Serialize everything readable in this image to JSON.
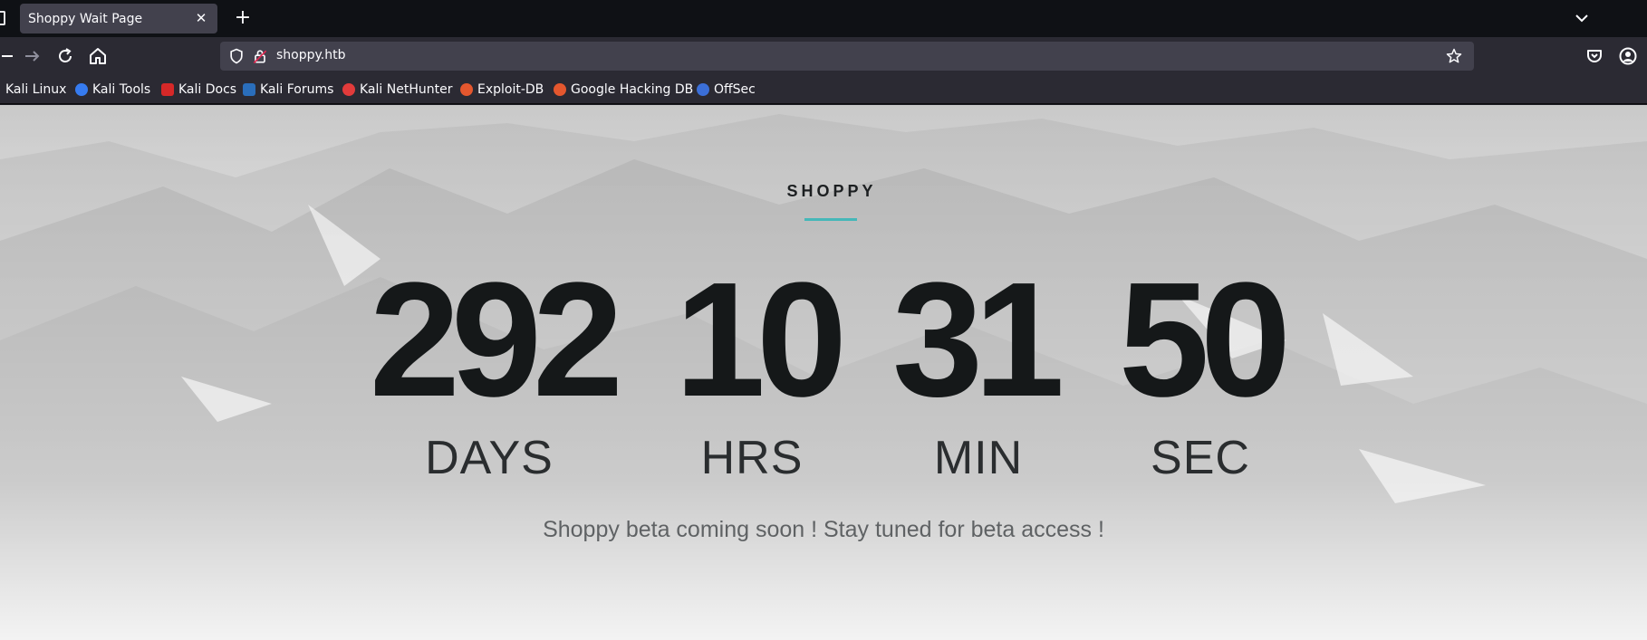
{
  "browser": {
    "tab": {
      "title": "Shoppy Wait Page"
    },
    "url": "shoppy.htb",
    "bookmarks": [
      {
        "label": "Kali Linux",
        "icon": "kali-dragon-icon",
        "color": "#367bf0"
      },
      {
        "label": "Kali Tools",
        "icon": "kali-tools-icon",
        "color": "#e33a3a"
      },
      {
        "label": "Kali Docs",
        "icon": "kali-docs-icon",
        "color": "#d62828"
      },
      {
        "label": "Kali Forums",
        "icon": "kali-forums-icon",
        "color": "#2a6ebb"
      },
      {
        "label": "Kali NetHunter",
        "icon": "kali-nethunter-icon",
        "color": "#e23b3b"
      },
      {
        "label": "Exploit-DB",
        "icon": "exploit-db-icon",
        "color": "#e4572e"
      },
      {
        "label": "Google Hacking DB",
        "icon": "ghdb-icon",
        "color": "#e4572e"
      },
      {
        "label": "OffSec",
        "icon": "offsec-icon",
        "color": "#3b6fd8"
      }
    ]
  },
  "page": {
    "brand": "SHOPPY",
    "countdown": [
      {
        "value": "292",
        "label": "DAYS"
      },
      {
        "value": "10",
        "label": "HRS"
      },
      {
        "value": "31",
        "label": "MIN"
      },
      {
        "value": "50",
        "label": "SEC"
      }
    ],
    "tagline": "Shoppy beta coming soon ! Stay tuned for beta access !",
    "accent_color": "#45b7b8"
  }
}
